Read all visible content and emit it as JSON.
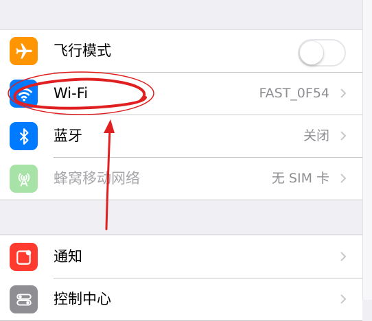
{
  "settings_group_1": {
    "airplane_mode": {
      "label": "飞行模式",
      "toggle_on": false,
      "icon": "airplane-icon",
      "color": "#ff9500"
    },
    "wifi": {
      "label": "Wi-Fi",
      "value": "FAST_0F54",
      "icon": "wifi-icon",
      "color": "#007aff"
    },
    "bluetooth": {
      "label": "蓝牙",
      "value": "关闭",
      "icon": "bluetooth-icon",
      "color": "#007aff"
    },
    "cellular": {
      "label": "蜂窝移动网络",
      "value": "无 SIM 卡",
      "icon": "cellular-antenna-icon",
      "color": "#a7e3a7"
    }
  },
  "settings_group_2": {
    "notifications": {
      "label": "通知",
      "icon": "notifications-icon",
      "color": "#ff3b30"
    },
    "control_center": {
      "label": "控制中心",
      "icon": "control-center-icon",
      "color": "#8e8e93"
    }
  },
  "annotation": {
    "color": "#e02020"
  }
}
